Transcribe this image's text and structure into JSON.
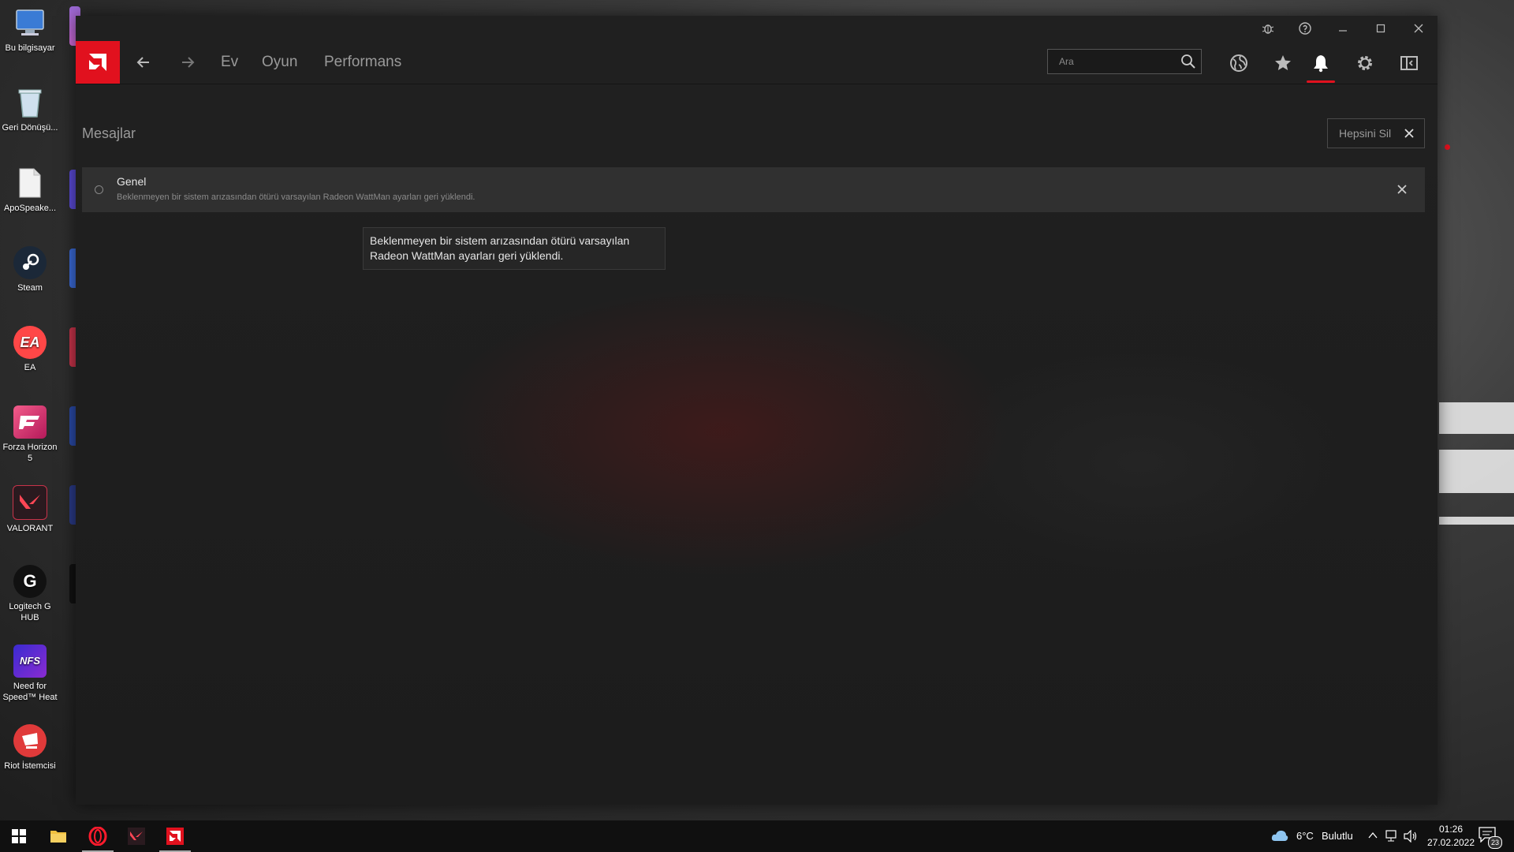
{
  "desktop": {
    "icons": [
      {
        "label": "Bu bilgisayar",
        "icon": "computer-icon",
        "color": "#3a7bd5"
      },
      {
        "label": "Geri Dönüşü...",
        "icon": "recycle-bin-icon",
        "color": "#9fb7c9"
      },
      {
        "label": "ApoSpeake...",
        "icon": "file-icon",
        "color": "#e9e9e9"
      },
      {
        "label": "Steam",
        "icon": "steam-icon",
        "color": "#1b2838"
      },
      {
        "label": "EA",
        "icon": "ea-icon",
        "color": "#ff4747"
      },
      {
        "label": "Forza Horizon 5",
        "icon": "forza-icon",
        "color": "#e4406f"
      },
      {
        "label": "VALORANT",
        "icon": "valorant-icon",
        "color": "#c8334a"
      },
      {
        "label": "Logitech G HUB",
        "icon": "logitech-icon",
        "color": "#1a1a1a"
      },
      {
        "label": "Need for Speed™ Heat",
        "icon": "nfs-icon",
        "color": "#5b2bd1"
      },
      {
        "label": "Riot İstemcisi",
        "icon": "riot-icon",
        "color": "#e03a3a"
      }
    ],
    "icon_marks": {
      "ea": "EA",
      "nfs": "NFS",
      "logitech": "G"
    }
  },
  "window": {
    "nav": {
      "home": "Ev",
      "gaming": "Oyun",
      "performance": "Performans"
    },
    "search": {
      "placeholder": "Ara"
    },
    "content": {
      "title": "Mesajlar",
      "clear_all": "Hepsini Sil",
      "messages": [
        {
          "category": "Genel",
          "text": "Beklenmeyen bir sistem arızasından ötürü varsayılan Radeon WattMan ayarları geri yüklendi."
        }
      ],
      "tooltip": "Beklenmeyen bir sistem arızasından ötürü varsayılan Radeon WattMan ayarları geri yüklendi."
    },
    "accent_color": "#e1111e"
  },
  "taskbar": {
    "weather": {
      "temp": "6°C",
      "condition": "Bulutlu"
    },
    "time": "01:26",
    "date": "27.02.2022",
    "notification_count": "23"
  }
}
